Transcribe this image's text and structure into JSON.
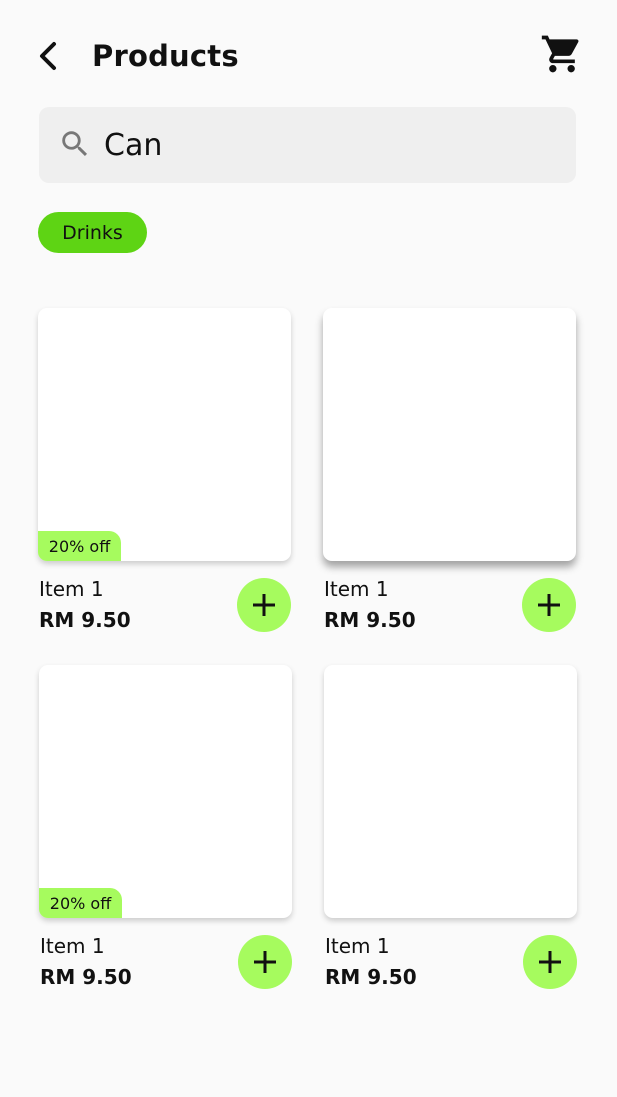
{
  "header": {
    "title": "Products",
    "back_icon": "chevron-left-icon",
    "cart_icon": "shopping-cart-icon"
  },
  "search": {
    "value": "Can",
    "icon": "search-icon"
  },
  "filters": [
    {
      "label": "Drinks",
      "selected": true
    }
  ],
  "products": [
    {
      "name": "Item 1",
      "price": "RM 9.50",
      "badge": "20% off"
    },
    {
      "name": "Item 1",
      "price": "RM 9.50",
      "badge": null
    },
    {
      "name": "Item 1",
      "price": "RM 9.50",
      "badge": "20% off"
    },
    {
      "name": "Item 1",
      "price": "RM 9.50",
      "badge": null
    }
  ],
  "add_icon": "plus-icon",
  "colors": {
    "accent": "#a6fb5e",
    "chip": "#5ed414",
    "search_bg": "#efefef",
    "background": "#fafafa"
  }
}
